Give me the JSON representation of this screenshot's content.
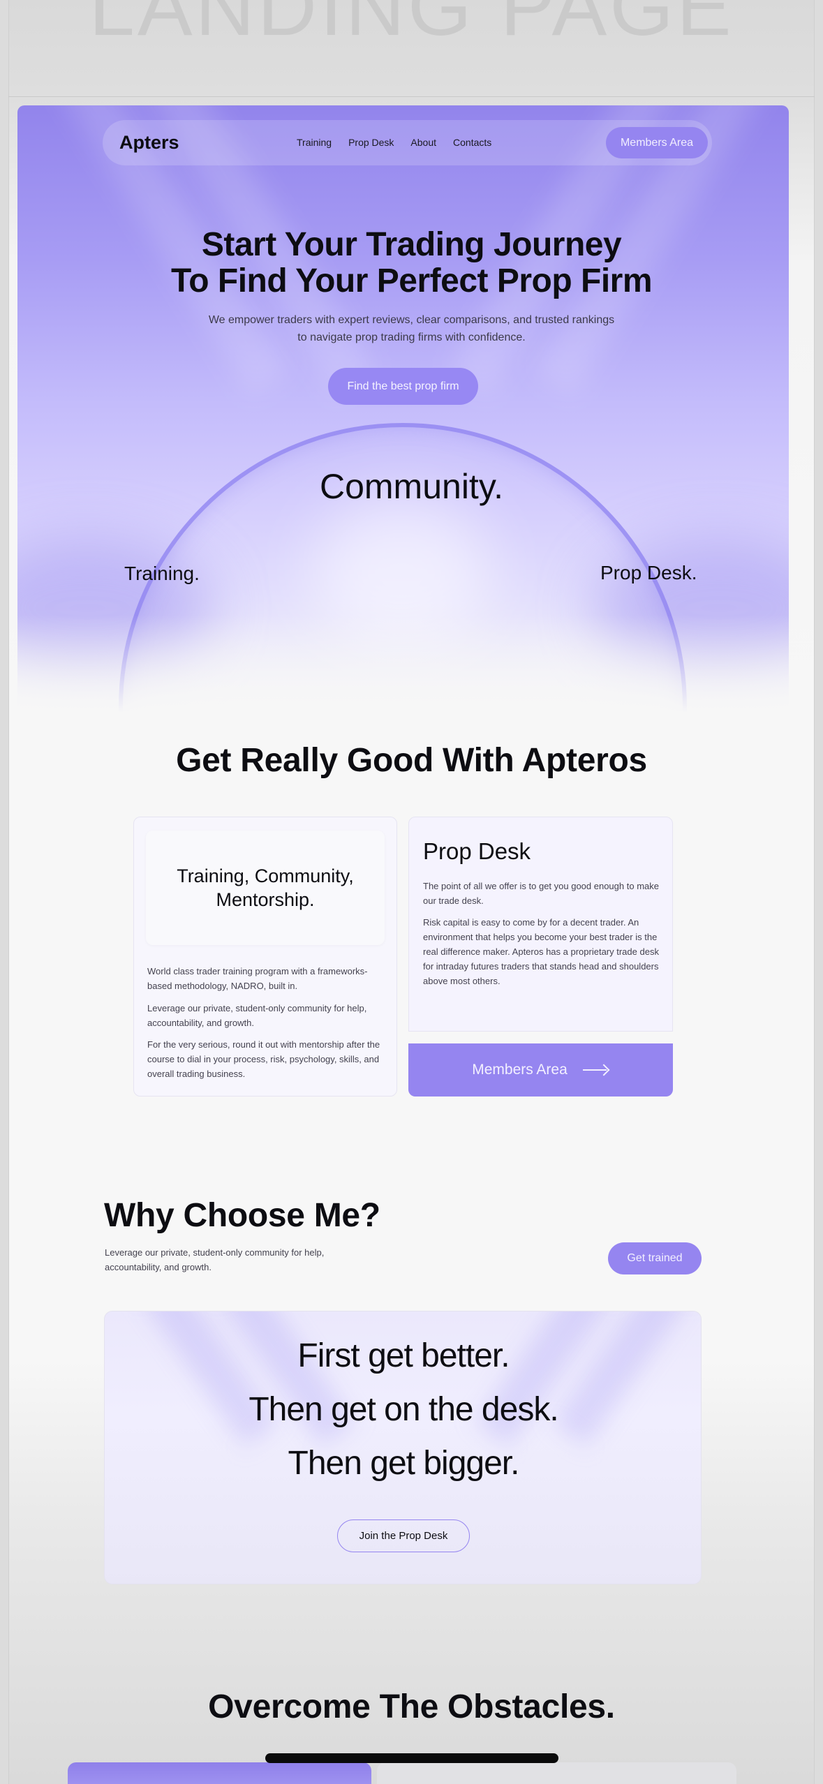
{
  "watermark": "LANDING PAGE",
  "nav": {
    "brand": "Apters",
    "links": [
      "Training",
      "Prop Desk",
      "About",
      "Contacts"
    ],
    "members_button": "Members Area"
  },
  "hero": {
    "title_line1": "Start Your Trading Journey",
    "title_line2": "To Find Your Perfect Prop Firm",
    "subtitle_line1": "We empower traders with expert reviews, clear comparisons, and trusted rankings",
    "subtitle_line2": "to navigate prop trading firms with confidence.",
    "cta": "Find the best prop firm",
    "word_center": "Community.",
    "word_left": "Training.",
    "word_right": "Prop Desk."
  },
  "section2": {
    "title": "Get Really Good With Apteros",
    "left_card": {
      "headline": "Training, Community, Mentorship.",
      "paragraphs": [
        "World class trader training program with a frameworks-based methodology, NADRO, built in.",
        "Leverage our private, student-only community for help, accountability, and growth.",
        "For the very serious, round it out with mentorship after the course to dial in your process, risk, psychology, skills, and overall trading business."
      ]
    },
    "right_card": {
      "title": "Prop Desk",
      "paragraphs": [
        "The point of all we offer is to get you good enough to make our trade desk.",
        "Risk capital is easy to come by for a decent trader. An environment that helps you become your best trader is the real difference maker. Apteros has a proprietary trade desk for intraday futures traders that stands head and shoulders above most others."
      ],
      "button": "Members Area"
    }
  },
  "section3": {
    "title": "Why Choose Me?",
    "subtitle": "Leverage our private, student-only community for help, accountability, and growth.",
    "button": "Get trained",
    "quote_lines": [
      "First get better.",
      "Then get on the desk.",
      "Then get bigger."
    ],
    "quote_button": "Join the Prop Desk"
  },
  "section4": {
    "title": "Overcome The Obstacles."
  }
}
